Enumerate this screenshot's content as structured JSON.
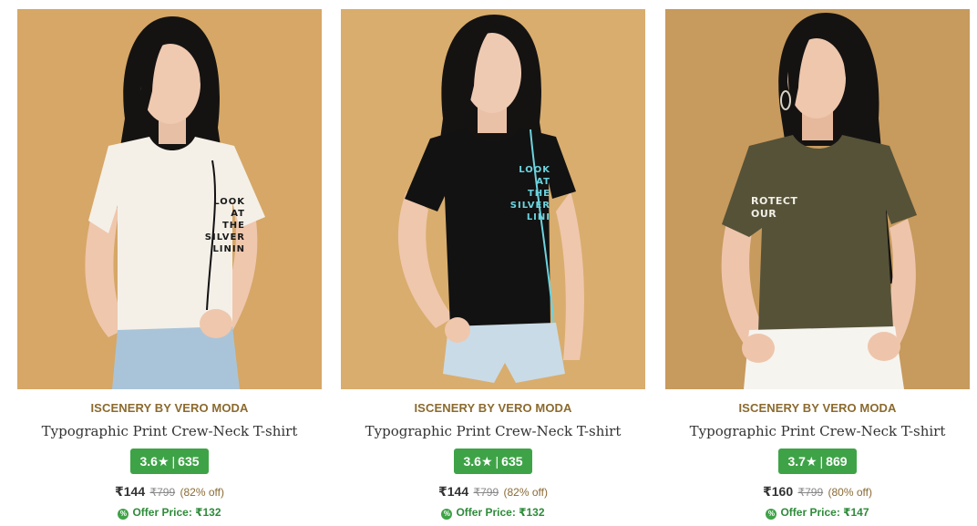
{
  "products": [
    {
      "brand": "ISCENERY BY VERO MODA",
      "title": "Typographic Print Crew-Neck T-shirt",
      "rating": "3.6",
      "star": "★",
      "rating_sep": "|",
      "reviews": "635",
      "price": "₹144",
      "mrp": "₹799",
      "discount": "(82% off)",
      "offer_icon": "%",
      "offer_price": "Offer Price: ₹132",
      "image_text": [
        "LOOK",
        "AT",
        "THE",
        "SILVER",
        "LININ"
      ],
      "image_icon": "model-in-white-tshirt-photo"
    },
    {
      "brand": "ISCENERY BY VERO MODA",
      "title": "Typographic Print Crew-Neck T-shirt",
      "rating": "3.6",
      "star": "★",
      "rating_sep": "|",
      "reviews": "635",
      "price": "₹144",
      "mrp": "₹799",
      "discount": "(82% off)",
      "offer_icon": "%",
      "offer_price": "Offer Price: ₹132",
      "image_text": [
        "LOOK",
        "AT",
        "THE",
        "SILVER",
        "LINI"
      ],
      "image_icon": "model-in-black-tshirt-photo"
    },
    {
      "brand": "ISCENERY BY VERO MODA",
      "title": "Typographic Print Crew-Neck T-shirt",
      "rating": "3.7",
      "star": "★",
      "rating_sep": "|",
      "reviews": "869",
      "price": "₹160",
      "mrp": "₹799",
      "discount": "(80% off)",
      "offer_icon": "%",
      "offer_price": "Offer Price: ₹147",
      "image_text": [
        "ROTECT",
        "OUR"
      ],
      "image_icon": "model-in-olive-tshirt-photo"
    }
  ],
  "colors": {
    "brand_text": "#8b6a2e",
    "rating_badge": "#3ea347",
    "offer_text": "#2e8b3a",
    "backdrop_1": "#d6a766",
    "backdrop_2": "#d9ad6d",
    "backdrop_3": "#c79a5d",
    "tee_1": "#f4f0e8",
    "tee_2": "#121212",
    "tee_3": "#555238"
  }
}
